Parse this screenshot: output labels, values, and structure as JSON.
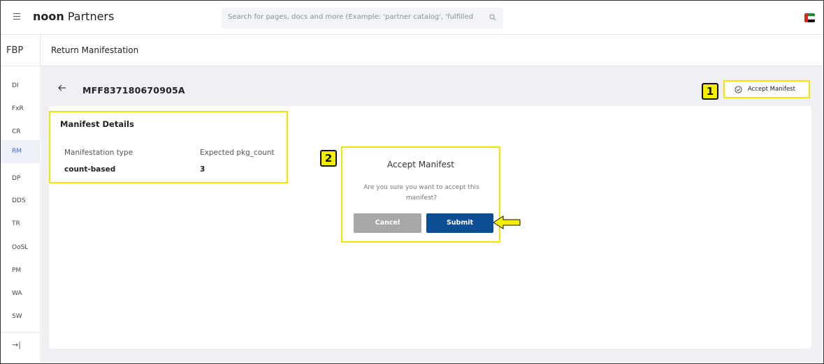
{
  "topbar": {
    "brand_bold": "noon",
    "brand_rest": " Partners",
    "search_placeholder": "Search for pages, docs and more (Example: 'partner catalog', 'fulfilled"
  },
  "sidebar": {
    "title": "FBP",
    "items": [
      {
        "label": "DI"
      },
      {
        "label": "FxR"
      },
      {
        "label": "CR"
      },
      {
        "label": "RM",
        "active": true
      },
      {
        "label": "DP"
      },
      {
        "label": "DDS"
      },
      {
        "label": "TR"
      },
      {
        "label": "OoSL"
      },
      {
        "label": "PM"
      },
      {
        "label": "WA"
      },
      {
        "label": "SW"
      }
    ],
    "collapse_glyph": "→|"
  },
  "page": {
    "title": "Return Manifestation",
    "manifest_id": "MFF837180670905A",
    "accept_button_label": "Accept Manifest"
  },
  "callouts": {
    "one": "1",
    "two": "2"
  },
  "details": {
    "title": "Manifest Details",
    "type_label": "Manifestation type",
    "type_value": "count-based",
    "count_label": "Expected pkg_count",
    "count_value": "3"
  },
  "modal": {
    "title": "Accept Manifest",
    "message": "Are you sure you want to accept this manifest?",
    "cancel_label": "Cancel",
    "submit_label": "Submit"
  },
  "colors": {
    "highlight": "#f5e400",
    "submit": "#0d4d93",
    "cancel": "#a8a8a8",
    "active_nav": "#3866df"
  }
}
